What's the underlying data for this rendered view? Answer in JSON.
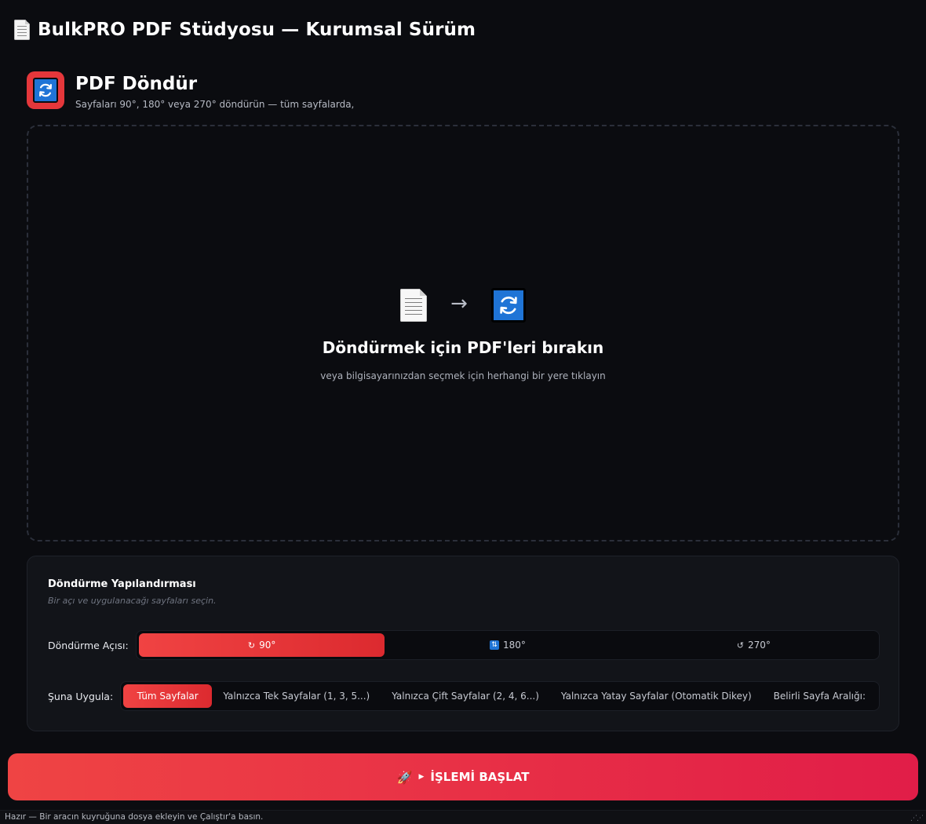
{
  "app": {
    "title": "BulkPRO PDF Stüdyosu — Kurumsal Sürüm",
    "icon": "document-icon"
  },
  "tool": {
    "title": "PDF Döndür",
    "subtitle": "Sayfaları 90°, 180° veya 270° döndürün — tüm sayfalarda,",
    "icon": "rotate-icon",
    "accent": "#e5373b",
    "icon_bg": "#1f74d6"
  },
  "dropzone": {
    "arrow": "→",
    "title": "Döndürmek için PDF'leri bırakın",
    "subtitle": "veya bilgisayarınızdan seçmek için herhangi bir yere tıklayın"
  },
  "config": {
    "title": "Döndürme Yapılandırması",
    "subtitle": "Bir açı ve uygulanacağı sayfaları seçin.",
    "angle_label": "Döndürme Açısı:",
    "angle_options": [
      {
        "label": "90°",
        "icon": "rotate-cw-icon",
        "selected": true
      },
      {
        "label": "180°",
        "icon": "flip-icon",
        "selected": false
      },
      {
        "label": "270°",
        "icon": "rotate-ccw-icon",
        "selected": false
      }
    ],
    "apply_label": "Şuna Uygula:",
    "apply_options": [
      {
        "label": "Tüm Sayfalar",
        "selected": true
      },
      {
        "label": "Yalnızca Tek Sayfalar (1, 3, 5...)",
        "selected": false
      },
      {
        "label": "Yalnızca Çift Sayfalar (2, 4, 6...)",
        "selected": false
      },
      {
        "label": "Yalnızca Yatay Sayfalar (Otomatik Dikey)",
        "selected": false
      },
      {
        "label": "Belirli Sayfa Aralığı:",
        "selected": false
      }
    ]
  },
  "run": {
    "label": "İŞLEMİ BAŞLAT",
    "icon": "rocket-icon",
    "gradient_start": "#ef4444",
    "gradient_end": "#e11d48"
  },
  "status": {
    "text": "Hazır — Bir aracın kuyruğuna dosya ekleyin ve Çalıştır'a basın."
  }
}
